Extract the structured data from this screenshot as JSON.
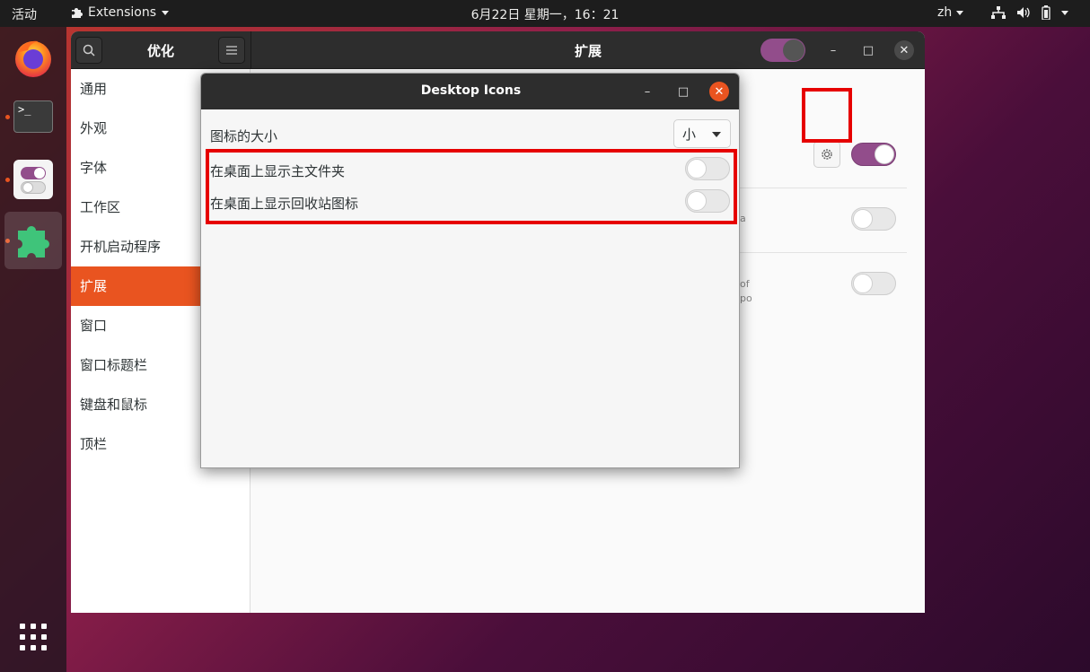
{
  "topbar": {
    "activities": "活动",
    "app_menu": "Extensions",
    "clock": "6月22日 星期一，16：21",
    "language": "zh"
  },
  "dock": {
    "items": [
      "firefox-icon",
      "terminal-icon",
      "tweaks-icon",
      "extensions-icon",
      "show-apps-icon"
    ]
  },
  "main_window": {
    "sidebar_title": "优化",
    "title": "扩展",
    "sidebar_items": [
      "通用",
      "外观",
      "字体",
      "工作区",
      "开机启动程序",
      "扩展",
      "窗口",
      "窗口标题栏",
      "键盘和鼠标",
      "顶栏"
    ],
    "selected_item": "扩展",
    "fragments": [
      "a",
      "of",
      "po"
    ]
  },
  "dialog": {
    "title": "Desktop Icons",
    "icon_size_label": "图标的大小",
    "icon_size_value": "小",
    "show_home_label": "在桌面上显示主文件夹",
    "show_trash_label": "在桌面上显示回收站图标"
  },
  "colors": {
    "accent": "#e95420",
    "toggle_on": "#924d8b",
    "highlight": "#e60000"
  }
}
